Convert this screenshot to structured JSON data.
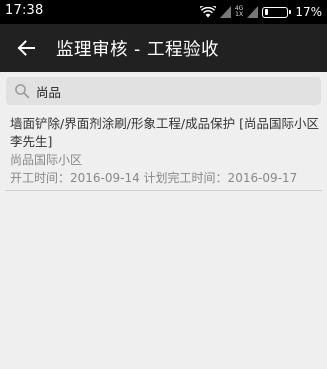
{
  "status": {
    "time": "17:38",
    "net_top": "4G",
    "net_bottom": "1X",
    "battery": "17%",
    "battery_level": 0.17
  },
  "header": {
    "title": "监理审核 - 工程验收",
    "back_icon": "arrow-left-icon"
  },
  "search": {
    "value": "尚品",
    "icon": "search-icon"
  },
  "results": [
    {
      "title": "墙面铲除/界面剂涂刷/形象工程/成品保护 [尚品国际小区 李先生]",
      "community": "尚品国际小区",
      "dates": "开工时间：2016-09-14  计划完工时间：2016-09-17"
    }
  ]
}
